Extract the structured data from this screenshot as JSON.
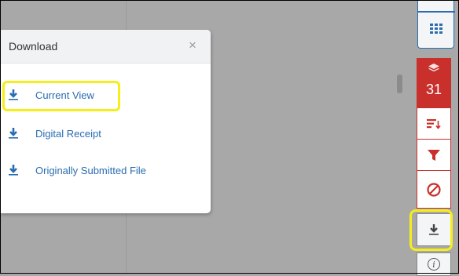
{
  "panel": {
    "title": "Download",
    "close_symbol": "×",
    "items": [
      {
        "label": "Current View",
        "icon": "download-icon",
        "highlighted": true
      },
      {
        "label": "Digital Receipt",
        "icon": "download-icon"
      },
      {
        "label": "Originally Submitted File",
        "icon": "download-icon"
      }
    ]
  },
  "toolbar": {
    "grid_icon": "grid-icon",
    "layers_icon": "layers-icon",
    "layer_count": "31",
    "buttons": [
      {
        "icon": "sort-icon"
      },
      {
        "icon": "filter-icon"
      },
      {
        "icon": "clear-filter-icon"
      }
    ],
    "download_icon": "download-icon",
    "download_highlighted": true,
    "info_symbol": "i"
  },
  "colors": {
    "background": "#a8a8a8",
    "accent_blue": "#2a6db0",
    "accent_red": "#c9302c",
    "highlight_yellow": "#f5ee1b"
  }
}
